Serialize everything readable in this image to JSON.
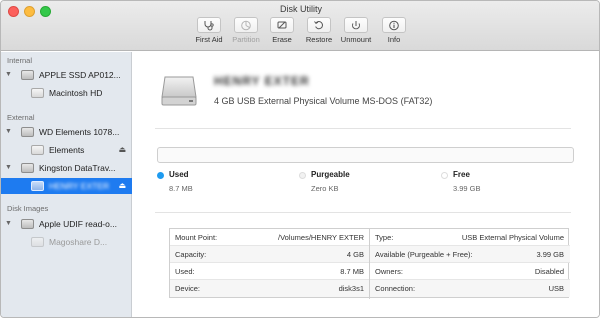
{
  "window": {
    "title": "Disk Utility"
  },
  "toolbar": {
    "buttons": [
      {
        "label": "First Aid",
        "icon": "stethoscope-icon",
        "enabled": true
      },
      {
        "label": "Partition",
        "icon": "pie-chart-icon",
        "enabled": false
      },
      {
        "label": "Erase",
        "icon": "eraser-icon",
        "enabled": true
      },
      {
        "label": "Restore",
        "icon": "restore-icon",
        "enabled": true
      },
      {
        "label": "Unmount",
        "icon": "unmount-icon",
        "enabled": true
      },
      {
        "label": "Info",
        "icon": "info-icon",
        "enabled": true
      }
    ]
  },
  "sidebar": {
    "internal_header": "Internal",
    "external_header": "External",
    "images_header": "Disk Images",
    "items": [
      {
        "label": "APPLE SSD AP012...",
        "type": "disk"
      },
      {
        "label": "Macintosh HD",
        "type": "volume"
      },
      {
        "label": "WD Elements 1078...",
        "type": "disk"
      },
      {
        "label": "Elements",
        "type": "volume",
        "eject": "⏏"
      },
      {
        "label": "Kingston DataTrav...",
        "type": "disk"
      },
      {
        "label": "HENRY EXTER",
        "type": "volume",
        "eject": "⏏",
        "selected": true
      },
      {
        "label": "Apple UDIF read-o...",
        "type": "disk"
      },
      {
        "label": "Magoshare D...",
        "type": "volume",
        "dimmed": true
      }
    ]
  },
  "volume": {
    "name": "HENRY EXTER",
    "description": "4 GB USB External Physical Volume MS-DOS (FAT32)"
  },
  "usage": {
    "used_label": "Used",
    "used_value": "8.7 MB",
    "used_color": "#1e9bf0",
    "purgeable_label": "Purgeable",
    "purgeable_value": "Zero KB",
    "purgeable_color": "#f4f4f4",
    "free_label": "Free",
    "free_value": "3.99 GB",
    "free_color": "#ffffff"
  },
  "info": {
    "left": [
      {
        "key": "Mount Point:",
        "value": "/Volumes/HENRY EXTER"
      },
      {
        "key": "Capacity:",
        "value": "4 GB"
      },
      {
        "key": "Used:",
        "value": "8.7 MB"
      },
      {
        "key": "Device:",
        "value": "disk3s1"
      }
    ],
    "right": [
      {
        "key": "Type:",
        "value": "USB External Physical Volume"
      },
      {
        "key": "Available (Purgeable + Free):",
        "value": "3.99 GB"
      },
      {
        "key": "Owners:",
        "value": "Disabled"
      },
      {
        "key": "Connection:",
        "value": "USB"
      }
    ]
  }
}
